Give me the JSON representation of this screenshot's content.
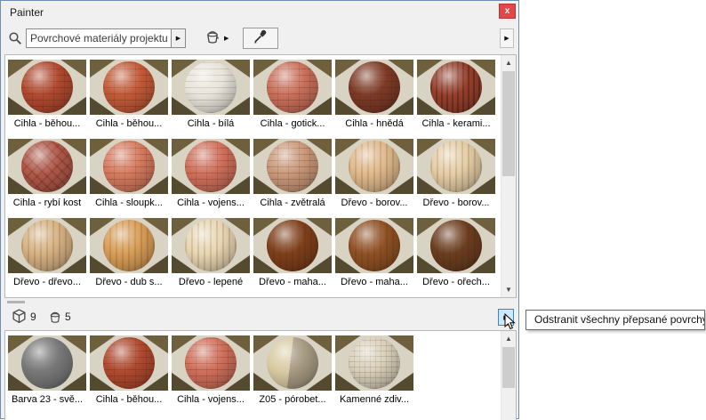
{
  "window": {
    "title": "Painter",
    "close_glyph": "x"
  },
  "icons": {
    "combo_flyout": "▶",
    "bucket_dropdown": "▶",
    "toolbar_flyout": "▶",
    "overrides_flyout": "▶",
    "scroll_up": "▲",
    "scroll_down": "▼"
  },
  "toolbar": {
    "search_value": "Povrchové materiály projektu"
  },
  "counts": {
    "materials": "9",
    "overrides": "5"
  },
  "popup": {
    "label": "Odstranit všechny přepsané povrchy"
  },
  "colors": {
    "accent_border": "#2f86d6",
    "accent_fill": "#cde8ff",
    "close_red": "#e04848"
  },
  "main_grid": {
    "items": [
      {
        "label": "Cihla - běhou...",
        "color": "#b0492f",
        "tex": "brick"
      },
      {
        "label": "Cihla - běhou...",
        "color": "#c25a38",
        "tex": "brick"
      },
      {
        "label": "Cihla - bílá",
        "color": "#e9e4db",
        "tex": "brickLight"
      },
      {
        "label": "Cihla - gotick...",
        "color": "#c9705a",
        "tex": "brick"
      },
      {
        "label": "Cihla - hnědá",
        "color": "#7d3a26",
        "tex": "brick"
      },
      {
        "label": "Cihla - kerami...",
        "color": "#96402c",
        "tex": "stripes"
      },
      {
        "label": "Cihla - rybí kost",
        "color": "#b05848",
        "tex": "herring"
      },
      {
        "label": "Cihla - sloupk...",
        "color": "#d57a5e",
        "tex": "brick"
      },
      {
        "label": "Cihla - vojens...",
        "color": "#cf6f5a",
        "tex": "brick"
      },
      {
        "label": "Cihla - zvětralá",
        "color": "#c99879",
        "tex": "brick"
      },
      {
        "label": "Dřevo - borov...",
        "color": "#dfb98c",
        "tex": "wood"
      },
      {
        "label": "Dřevo - borov...",
        "color": "#e4cda6",
        "tex": "wood"
      },
      {
        "label": "Dřevo - dřevo...",
        "color": "#d6b284",
        "tex": "wood"
      },
      {
        "label": "Dřevo - dub s...",
        "color": "#d89e58",
        "tex": "wood"
      },
      {
        "label": "Dřevo - lepené",
        "color": "#e8d6b2",
        "tex": "wood"
      },
      {
        "label": "Dřevo - maha...",
        "color": "#7e3f1b",
        "tex": "wood"
      },
      {
        "label": "Dřevo - maha...",
        "color": "#8f5124",
        "tex": "wood"
      },
      {
        "label": "Dřevo - ořech...",
        "color": "#6b3d20",
        "tex": "wood"
      }
    ]
  },
  "bottom_grid": {
    "items": [
      {
        "label": "Barva 23 - svě...",
        "color": "#787878",
        "tex": "none"
      },
      {
        "label": "Cihla - běhou...",
        "color": "#b0492f",
        "tex": "brick"
      },
      {
        "label": "Cihla - vojens...",
        "color": "#cf6f5a",
        "tex": "brick"
      },
      {
        "label": "Z05 - pórobet...",
        "color": "#c9bb96",
        "tex": "split"
      },
      {
        "label": "Kamenné zdiv...",
        "color": "#d9cfba",
        "tex": "stone"
      }
    ]
  }
}
